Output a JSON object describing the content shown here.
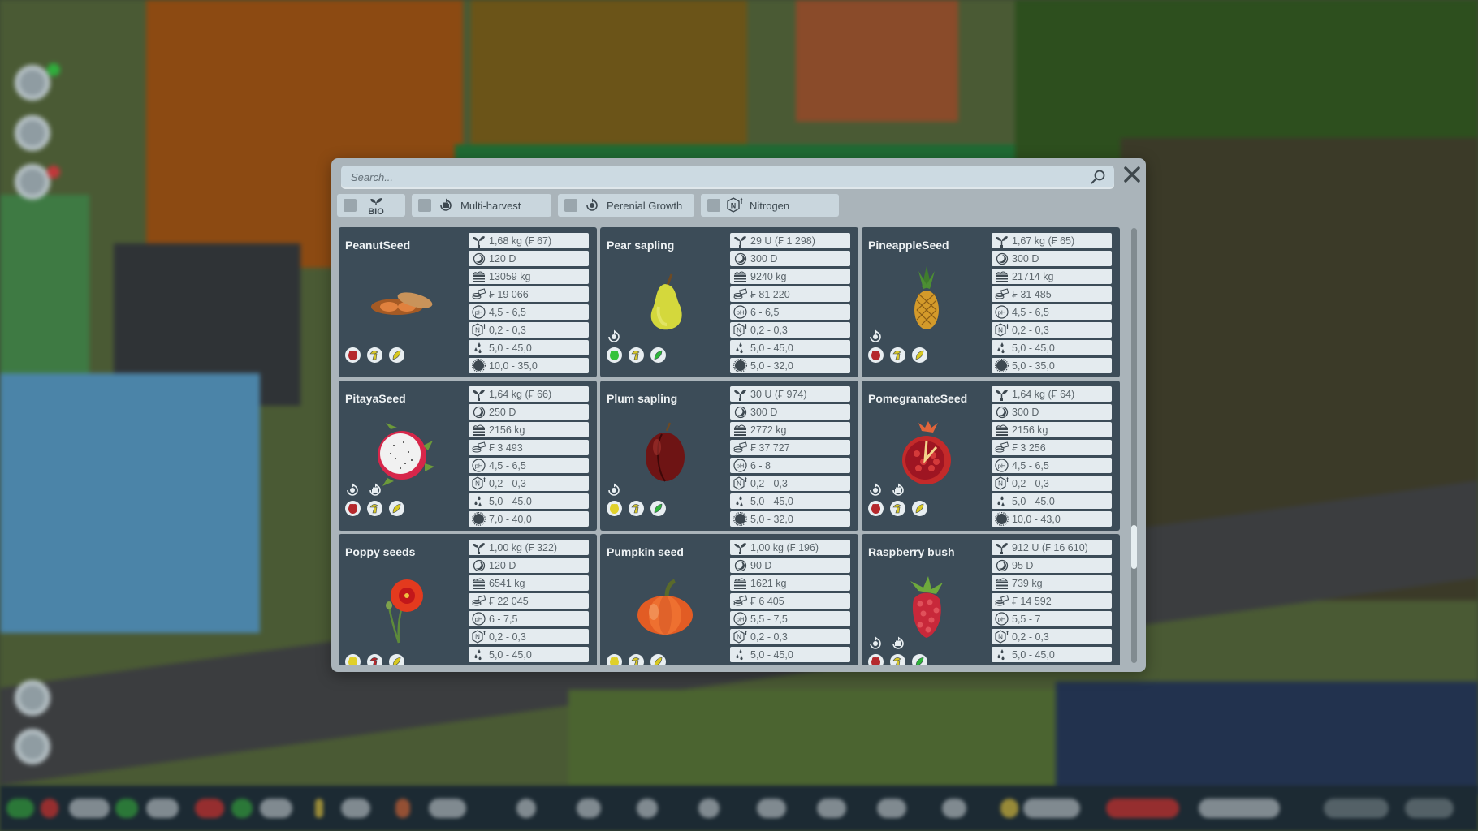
{
  "search": {
    "placeholder": "Search...",
    "value": ""
  },
  "filters": [
    {
      "id": "bio",
      "label": "BIO",
      "icon": "bio-sprout-icon",
      "checked": false
    },
    {
      "id": "multi_harvest",
      "label": "Multi-harvest",
      "icon": "multi-harvest-icon",
      "checked": false
    },
    {
      "id": "perenial_growth",
      "label": "Perenial Growth",
      "icon": "perennial-growth-icon",
      "checked": false
    },
    {
      "id": "nitrogen",
      "label": "Nitrogen",
      "icon": "nitrogen-icon",
      "checked": false
    }
  ],
  "stat_icons": [
    "seed-cost-icon",
    "growth-days-icon",
    "yield-icon",
    "revenue-icon",
    "ph-icon",
    "nitrogen-icon",
    "humidity-icon",
    "temperature-icon"
  ],
  "crops": [
    {
      "name": "PeanutSeed",
      "image": "peanut",
      "traits": [],
      "badges": [
        "pest-red",
        "fungus-yellow",
        "leaf-yellow"
      ],
      "stats": [
        "1,68 kg (₣ 67)",
        "120 D",
        "13059 kg",
        "₣ 19 066",
        "4,5 - 6,5",
        "0,2 - 0,3",
        "5,0 - 45,0",
        "10,0 - 35,0"
      ]
    },
    {
      "name": "Pear sapling",
      "image": "pear",
      "traits": [
        "perennial"
      ],
      "badges": [
        "pest-green",
        "fungus-yellow",
        "leaf-green"
      ],
      "stats": [
        "29 U (₣ 1 298)",
        "300 D",
        "9240 kg",
        "₣ 81 220",
        "6 - 6,5",
        "0,2 - 0,3",
        "5,0 - 45,0",
        "5,0 - 32,0"
      ]
    },
    {
      "name": "PineappleSeed",
      "image": "pineapple",
      "traits": [
        "perennial"
      ],
      "badges": [
        "pest-red",
        "fungus-yellow",
        "leaf-yellow"
      ],
      "stats": [
        "1,67 kg (₣ 65)",
        "300 D",
        "21714 kg",
        "₣ 31 485",
        "4,5 - 6,5",
        "0,2 - 0,3",
        "5,0 - 45,0",
        "5,0 - 35,0"
      ]
    },
    {
      "name": "PitayaSeed",
      "image": "pitaya",
      "traits": [
        "perennial",
        "multi-harvest"
      ],
      "badges": [
        "pest-red",
        "fungus-yellow",
        "leaf-yellow"
      ],
      "stats": [
        "1,64 kg (₣ 66)",
        "250 D",
        "2156 kg",
        "₣ 3 493",
        "4,5 - 6,5",
        "0,2 - 0,3",
        "5,0 - 45,0",
        "7,0 - 40,0"
      ]
    },
    {
      "name": "Plum sapling",
      "image": "plum",
      "traits": [
        "perennial"
      ],
      "badges": [
        "pest-yellow",
        "fungus-yellow",
        "leaf-green"
      ],
      "stats": [
        "30 U (₣ 974)",
        "300 D",
        "2772 kg",
        "₣ 37 727",
        "6 - 8",
        "0,2 - 0,3",
        "5,0 - 45,0",
        "5,0 - 32,0"
      ]
    },
    {
      "name": "PomegranateSeed",
      "image": "pomegranate",
      "traits": [
        "perennial",
        "multi-harvest"
      ],
      "badges": [
        "pest-red",
        "fungus-yellow",
        "leaf-yellow"
      ],
      "stats": [
        "1,64 kg (₣ 64)",
        "300 D",
        "2156 kg",
        "₣ 3 256",
        "4,5 - 6,5",
        "0,2 - 0,3",
        "5,0 - 45,0",
        "10,0 - 43,0"
      ]
    },
    {
      "name": "Poppy seeds",
      "image": "poppy",
      "traits": [],
      "badges": [
        "pest-yellow",
        "fungus-red",
        "leaf-yellow"
      ],
      "stats": [
        "1,00 kg (₣ 322)",
        "120 D",
        "6541 kg",
        "₣ 22 045",
        "6 - 7,5",
        "0,2 - 0,3",
        "5,0 - 45,0",
        ""
      ]
    },
    {
      "name": "Pumpkin seed",
      "image": "pumpkin",
      "traits": [],
      "badges": [
        "pest-yellow",
        "fungus-yellow",
        "leaf-yellow"
      ],
      "stats": [
        "1,00 kg (₣ 196)",
        "90 D",
        "1621 kg",
        "₣ 6 405",
        "5,5 - 7,5",
        "0,2 - 0,3",
        "5,0 - 45,0",
        ""
      ]
    },
    {
      "name": "Raspberry bush",
      "image": "raspberry",
      "traits": [
        "perennial",
        "multi-harvest"
      ],
      "badges": [
        "pest-red",
        "fungus-yellow",
        "leaf-green"
      ],
      "stats": [
        "912 U (₣ 16 610)",
        "95 D",
        "739 kg",
        "₣ 14 592",
        "5,5 - 7",
        "0,2 - 0,3",
        "5,0 - 45,0",
        ""
      ]
    }
  ],
  "scroll": {
    "position_fraction": 0.76
  },
  "colors": {
    "panel": "#aab4ba",
    "card": "#3c4c58",
    "stat_bg": "#e4ebef",
    "pest_red": "#b5282c",
    "pest_green": "#35c23a",
    "pest_yellow": "#e0d02a",
    "fungus": "#d7c62a",
    "leaf_yellow": "#d8c820",
    "leaf_green": "#2eb43a"
  }
}
